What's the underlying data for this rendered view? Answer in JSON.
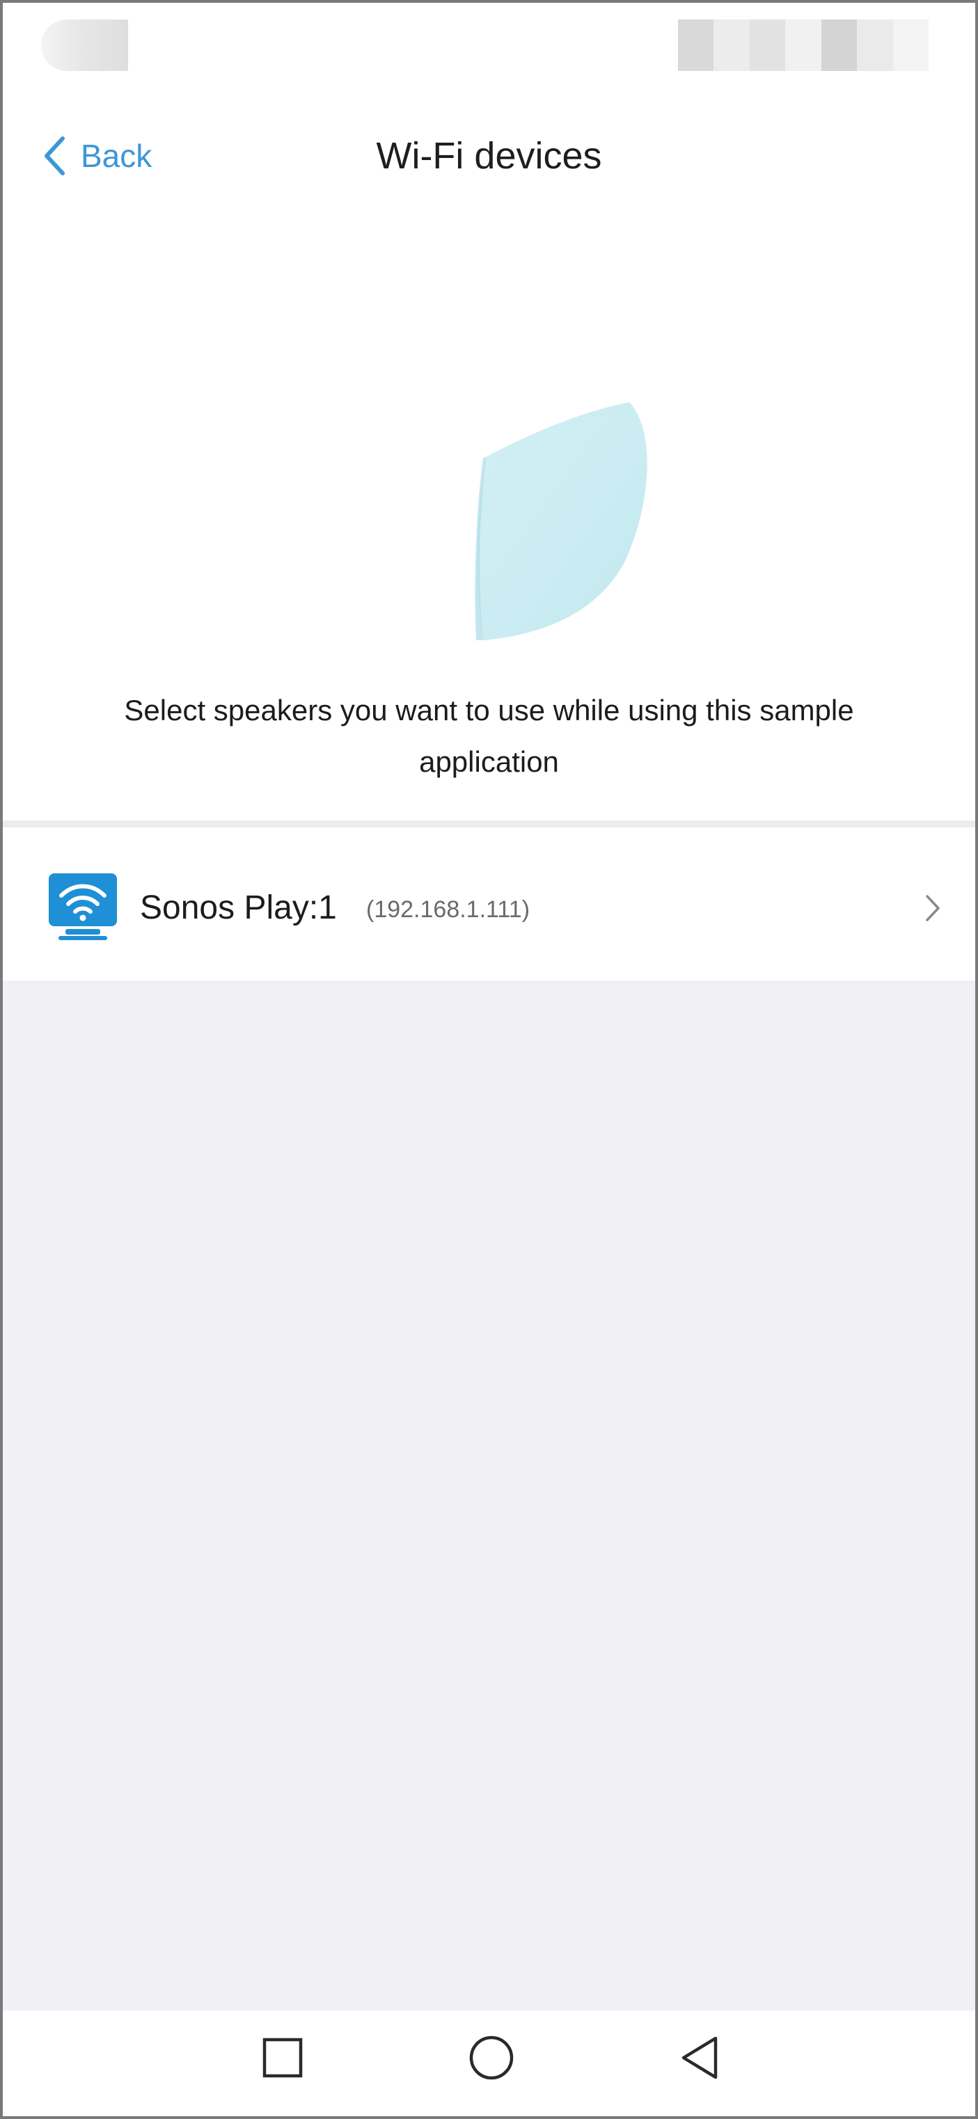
{
  "nav": {
    "back_label": "Back",
    "title": "Wi-Fi devices"
  },
  "description": "Select speakers you want to use while using this sample application",
  "devices": [
    {
      "name": "Sonos Play:1",
      "ip": "(192.168.1.111)",
      "icon": "wifi-display-icon"
    }
  ],
  "icons": {
    "back": "chevron-left-icon",
    "row_action": "chevron-right-icon",
    "system": [
      "square-recents-icon",
      "circle-home-icon",
      "triangle-back-icon"
    ]
  },
  "colors": {
    "accent": "#3d97d6",
    "list_background": "#f0f0f5",
    "device_icon": "#1f8fd6"
  }
}
